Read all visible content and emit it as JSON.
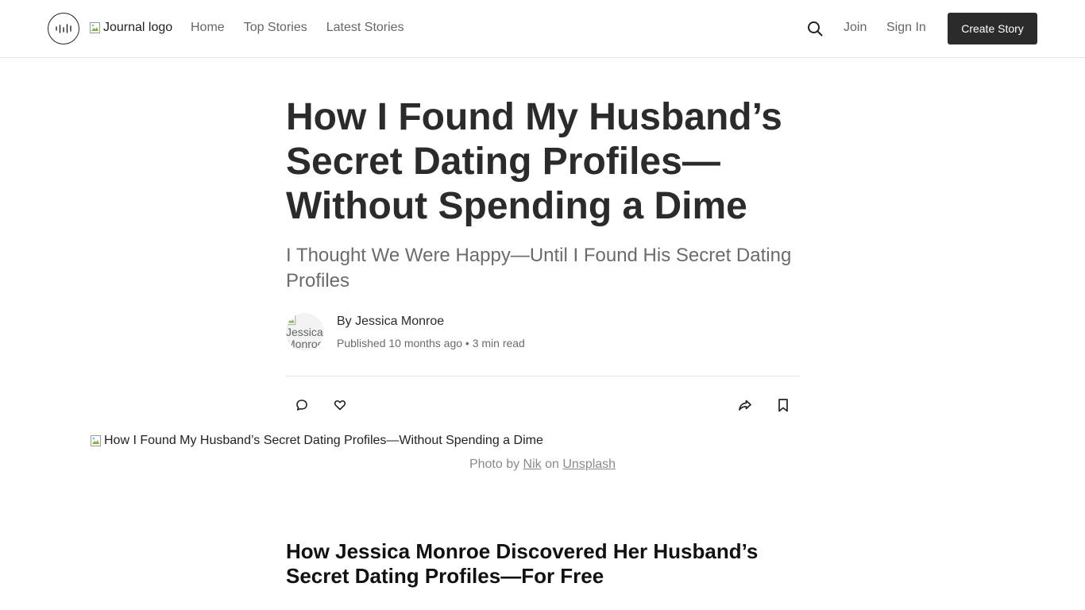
{
  "header": {
    "logo_icon": "waveform-logo-icon",
    "journal_logo_alt": "Journal logo",
    "nav": [
      "Home",
      "Top Stories",
      "Latest Stories"
    ],
    "search_icon": "search-icon",
    "join_label": "Join",
    "signin_label": "Sign In",
    "create_label": "Create Story",
    "create_bg": "#2b2b2b"
  },
  "article": {
    "title": "How I Found My Husband’s Secret Dating Profiles—Without Spending a Dime",
    "subtitle": "I Thought We Were Happy—Until I Found His Secret Dating Profiles",
    "avatar_alt": "Jessica Monroe",
    "byline": "By Jessica Monroe",
    "published_prefix": "Published",
    "published_time": "10 months ago",
    "separator": "•",
    "read_time": "3 min read",
    "actions": {
      "comment_icon": "comment-icon",
      "like_icon": "heart-icon",
      "share_icon": "share-icon",
      "bookmark_icon": "bookmark-icon"
    },
    "hero_alt": "How I Found My Husband’s Secret Dating Profiles—Without Spending a Dime",
    "caption_prefix": "Photo by",
    "caption_author": "Nik",
    "caption_mid": "on",
    "caption_source": "Unsplash",
    "section_heading": "How Jessica Monroe Discovered Her Husband’s Secret Dating Profiles—For Free"
  }
}
